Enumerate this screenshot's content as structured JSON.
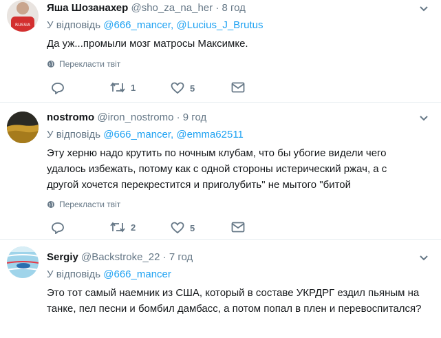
{
  "tweets": [
    {
      "name": "Яша Шозанахер",
      "handle": "@sho_za_na_her",
      "time": "· 8 год",
      "reply_prefix": "У відповідь",
      "reply_links": "@666_mancer, @Lucius_J_Brutus",
      "text": "Да уж...промыли мозг матросы Максимке.",
      "translate": "Перекласти твіт",
      "retweets": "1",
      "likes": "5"
    },
    {
      "name": "nostromo",
      "handle": "@iron_nostromo",
      "time": "· 9 год",
      "reply_prefix": "У відповідь",
      "reply_links": "@666_mancer, @emma62511",
      "text_lines": [
        "Эту херню надо крутить по ночным клубам, что бы убогие видели чего",
        "удалось избежать, потому как с одной стороны истерический ржач, а с",
        "другой хочется перекрестится и приголубить\" не мытого \"битой"
      ],
      "translate": "Перекласти твіт",
      "retweets": "2",
      "likes": "5"
    },
    {
      "name": "Sergiy",
      "handle": "@Backstroke_22",
      "time": "· 7 год",
      "reply_prefix": "У відповідь",
      "reply_links": "@666_mancer",
      "text_lines": [
        "Это тот самый наемник из США, который в составе УКРДРГ ездил пьяным на",
        "танке, пел песни и бомбил дамбасс, а потом попал в плен и перевоспитался?"
      ]
    }
  ],
  "colors": {
    "link": "#1da1f2",
    "muted": "#657786",
    "divider": "#e6ecf0"
  },
  "icons": [
    "reply-icon",
    "retweet-icon",
    "like-icon",
    "message-icon",
    "globe-icon",
    "chevron-down-icon"
  ]
}
